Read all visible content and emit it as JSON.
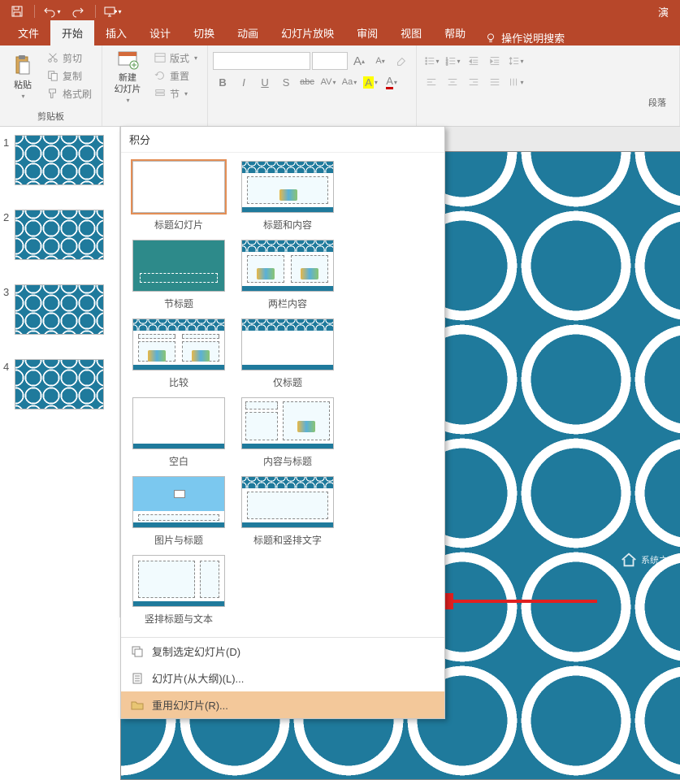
{
  "qat": {
    "title_fragment": "演",
    "buttons": [
      "save",
      "undo",
      "redo",
      "start-from-beginning"
    ]
  },
  "tabs": {
    "items": [
      "文件",
      "开始",
      "插入",
      "设计",
      "切换",
      "动画",
      "幻灯片放映",
      "审阅",
      "视图",
      "帮助"
    ],
    "active_index": 1,
    "tell_me": "操作说明搜索"
  },
  "ribbon": {
    "clipboard": {
      "paste": "粘贴",
      "cut": "剪切",
      "copy": "复制",
      "format_painter": "格式刷",
      "label": "剪贴板"
    },
    "slides": {
      "new_slide": "新建\n幻灯片",
      "layout": "版式",
      "reset": "重置",
      "section": "节"
    },
    "font": {
      "name_placeholder": "",
      "letters": {
        "b": "B",
        "i": "I",
        "u": "U",
        "s": "S",
        "abc": "abc",
        "av": "AV",
        "aa": "Aa",
        "a1": "A",
        "a2": "A"
      },
      "bigA": "A",
      "smallA": "A"
    },
    "paragraph": {
      "label": "段落"
    }
  },
  "thumbs": [
    "1",
    "2",
    "3",
    "4"
  ],
  "gallery": {
    "theme": "积分",
    "layouts": [
      {
        "id": "title",
        "label": "标题幻灯片"
      },
      {
        "id": "title_content",
        "label": "标题和内容"
      },
      {
        "id": "section",
        "label": "节标题"
      },
      {
        "id": "two_col",
        "label": "两栏内容"
      },
      {
        "id": "compare",
        "label": "比较"
      },
      {
        "id": "title_only",
        "label": "仅标题"
      },
      {
        "id": "blank",
        "label": "空白"
      },
      {
        "id": "content_caption",
        "label": "内容与标题"
      },
      {
        "id": "pic_caption",
        "label": "图片与标题"
      },
      {
        "id": "title_vtext",
        "label": "标题和竖排文字"
      },
      {
        "id": "vtitle_text",
        "label": "竖排标题与文本"
      }
    ],
    "footer": {
      "duplicate": "复制选定幻灯片(D)",
      "outline": "幻灯片(从大纲)(L)...",
      "reuse": "重用幻灯片(R)..."
    }
  },
  "watermark": "系统之家"
}
